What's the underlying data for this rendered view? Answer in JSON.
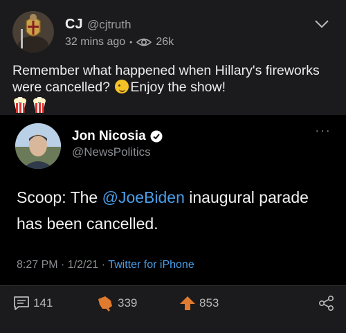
{
  "post": {
    "author_name": "CJ",
    "author_handle": "@cjtruth",
    "time_ago": "32 mins ago",
    "views": "26k",
    "text_line_part1": "Remember what happened when Hillary's fireworks were cancelled?",
    "text_line_part2": "Enjoy the show!",
    "emoji": {
      "wink": "wink-emoji",
      "popcorn": "popcorn-emoji"
    }
  },
  "embed": {
    "name": "Jon Nicosia",
    "handle": "@NewsPolitics",
    "more": "···",
    "text_prefix": "Scoop: The",
    "mention": "@JoeBiden",
    "text_suffix": "inaugural parade  has been cancelled.",
    "time": "8:27 PM · 1/2/21 ·",
    "source": "Twitter for iPhone"
  },
  "actions": {
    "comments": "141",
    "likes": "339",
    "upvotes": "853"
  },
  "colors": {
    "background": "#1b1b1d",
    "embed_background": "#000000",
    "link": "#4a9fe8",
    "accent_orange": "#e07a2e"
  }
}
